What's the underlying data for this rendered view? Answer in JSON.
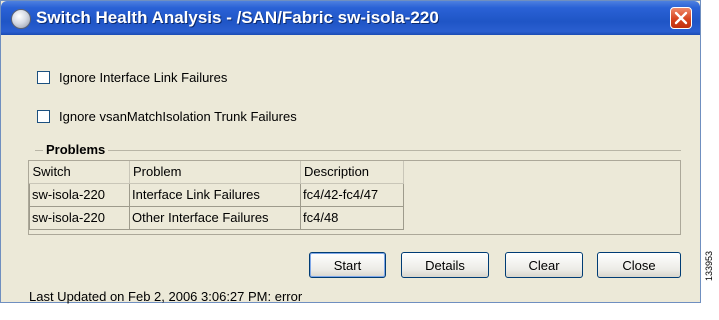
{
  "window": {
    "title": "Switch Health Analysis - /SAN/Fabric sw-isola-220"
  },
  "options": {
    "ignore_link_failures_label": "Ignore Interface Link Failures",
    "ignore_trunk_failures_label": "Ignore vsanMatchIsolation Trunk Failures",
    "ignore_link_failures_checked": false,
    "ignore_trunk_failures_checked": false
  },
  "problems": {
    "legend": "Problems",
    "columns": [
      "Switch",
      "Problem",
      "Description"
    ],
    "rows": [
      [
        "sw-isola-220",
        "Interface Link Failures",
        "fc4/42-fc4/47"
      ],
      [
        "sw-isola-220",
        "Other Interface Failures",
        "fc4/48"
      ]
    ]
  },
  "buttons": {
    "start": "Start",
    "details": "Details",
    "clear": "Clear",
    "close": "Close"
  },
  "status": "Last Updated on Feb 2, 2006 3:06:27 PM: error",
  "figure_number": "133953",
  "icons": {
    "app": "globe-icon",
    "close": "close-icon"
  },
  "colors": {
    "titlebar": "#2a62d6",
    "close_button": "#d6441f",
    "dialog_bg": "#ece9d8"
  }
}
